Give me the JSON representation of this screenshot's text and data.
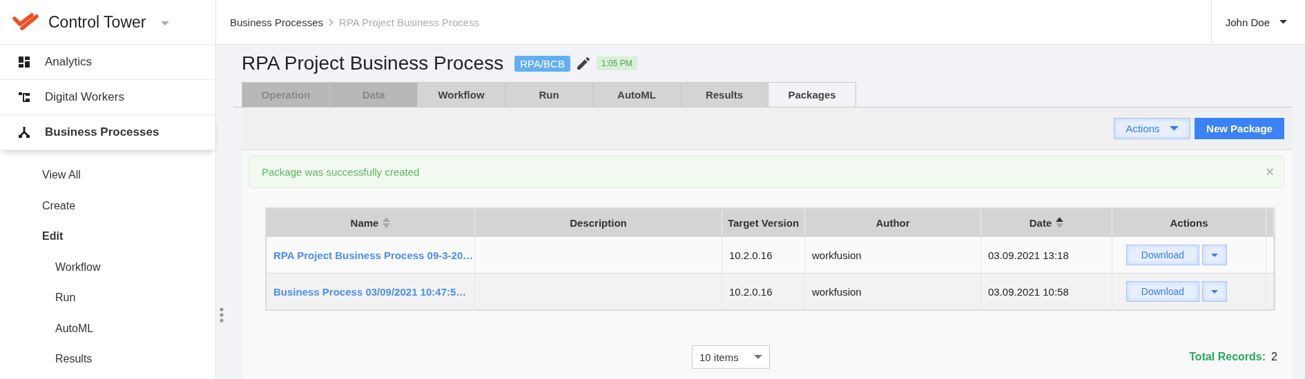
{
  "app": {
    "name": "Control Tower"
  },
  "breadcrumb": [
    {
      "label": "Business Processes",
      "current": false
    },
    {
      "label": "RPA Project Business Process",
      "current": true
    }
  ],
  "user": {
    "name": "John Doe"
  },
  "nav": [
    {
      "label": "Analytics",
      "selected": false
    },
    {
      "label": "Digital Workers",
      "selected": false
    },
    {
      "label": "Business Processes",
      "selected": true,
      "children": [
        {
          "label": "View All",
          "selected": false
        },
        {
          "label": "Create",
          "selected": false
        },
        {
          "label": "Edit",
          "selected": true,
          "children": [
            {
              "label": "Workflow",
              "selected": false
            },
            {
              "label": "Run",
              "selected": false
            },
            {
              "label": "AutoML",
              "selected": false
            },
            {
              "label": "Results",
              "selected": false
            }
          ]
        }
      ]
    }
  ],
  "page": {
    "title": "RPA Project Business Process",
    "tag": "RPA/BCB",
    "time": "1:05 PM"
  },
  "tabs": [
    {
      "label": "Operation",
      "selected": false,
      "disabled": true
    },
    {
      "label": "Data",
      "selected": false,
      "disabled": true
    },
    {
      "label": "Workflow",
      "selected": false,
      "disabled": false
    },
    {
      "label": "Run",
      "selected": false,
      "disabled": false
    },
    {
      "label": "AutoML",
      "selected": false,
      "disabled": false
    },
    {
      "label": "Results",
      "selected": false,
      "disabled": false
    },
    {
      "label": "Packages",
      "selected": true,
      "disabled": false
    }
  ],
  "toolbar": {
    "actions": "Actions",
    "new": "New Package"
  },
  "alert": {
    "message": "Package was successfully created",
    "close": "×"
  },
  "table": {
    "columns": [
      {
        "label": "Name",
        "kind": "sortable"
      },
      {
        "label": "Description",
        "kind": "plain"
      },
      {
        "label": "Target Version",
        "kind": "plain"
      },
      {
        "label": "Author",
        "kind": "plain"
      },
      {
        "label": "Date",
        "kind": "sorted"
      },
      {
        "label": "Actions",
        "kind": "plain"
      }
    ],
    "rows": [
      {
        "name": "RPA Project Business Process 09-3-20…",
        "description": "",
        "version": "10.2.0.16",
        "author": "workfusion",
        "date": "03.09.2021 13:18",
        "action": "Download"
      },
      {
        "name": "Business Process 03/09/2021 10:47:5…",
        "description": "",
        "version": "10.2.0.16",
        "author": "workfusion",
        "date": "03.09.2021 10:58",
        "action": "Download"
      }
    ]
  },
  "pager": {
    "page_size": "10 items",
    "total_label": "Total Records:",
    "total": "2"
  }
}
